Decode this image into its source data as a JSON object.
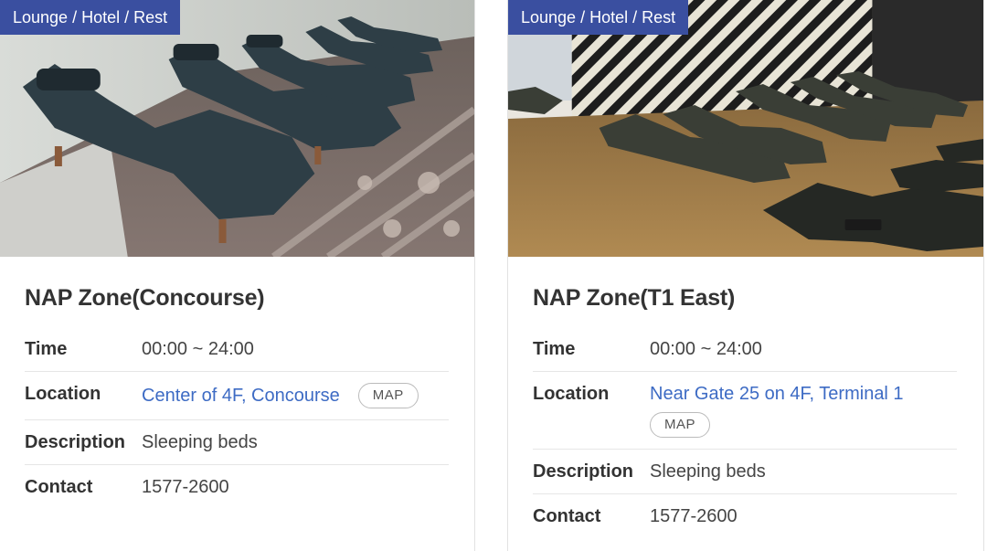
{
  "cards": [
    {
      "tag": "Lounge / Hotel / Rest",
      "title": "NAP Zone(Concourse)",
      "time_label": "Time",
      "time_value": "00:00 ~ 24:00",
      "location_label": "Location",
      "location_value": "Center of 4F, Concourse",
      "map_label": "MAP",
      "description_label": "Description",
      "description_value": "Sleeping beds",
      "contact_label": "Contact",
      "contact_value": "1577-2600"
    },
    {
      "tag": "Lounge / Hotel / Rest",
      "title": "NAP Zone(T1 East)",
      "time_label": "Time",
      "time_value": "00:00 ~ 24:00",
      "location_label": "Location",
      "location_value": "Near Gate 25 on 4F, Terminal 1",
      "map_label": "MAP",
      "description_label": "Description",
      "description_value": "Sleeping beds",
      "contact_label": "Contact",
      "contact_value": "1577-2600"
    }
  ],
  "colors": {
    "tag_bg": "#3a4fa0",
    "link": "#3d6bc4"
  }
}
